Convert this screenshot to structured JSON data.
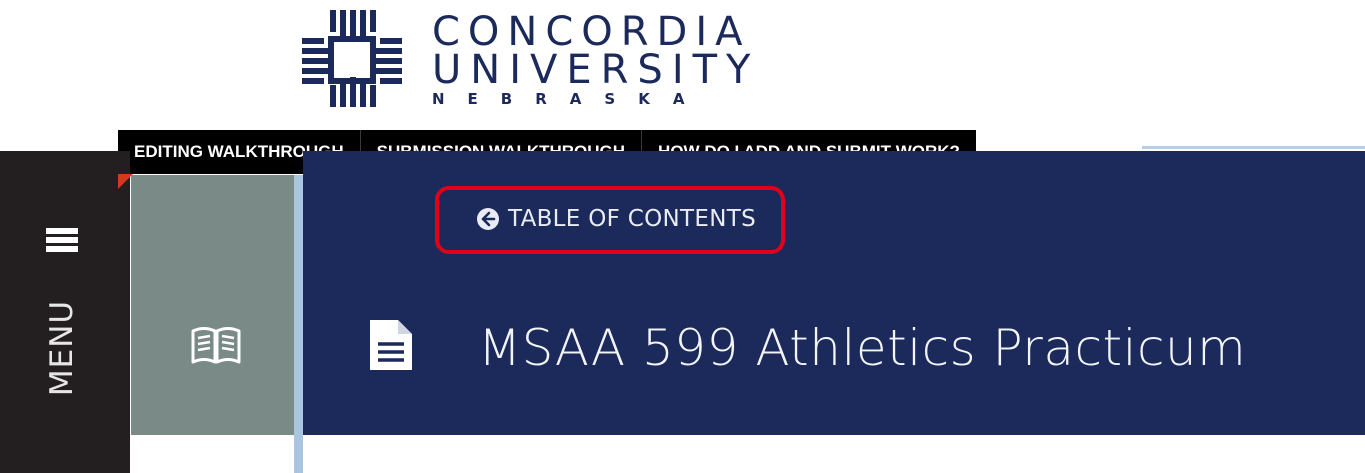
{
  "logo": {
    "line1": "CONCORDIA",
    "line2": "UNIVERSITY",
    "line3": "NEBRASKA",
    "color": "#1b2a5a"
  },
  "tabs": [
    {
      "label": "EDITING WALKTHROUGH"
    },
    {
      "label": "SUBMISSION WALKTHROUGH"
    },
    {
      "label": "HOW DO I ADD AND SUBMIT WORK?"
    }
  ],
  "sidebar": {
    "menu_label": "MENU",
    "menu_icon": "hamburger-icon",
    "book_icon": "open-book-icon"
  },
  "header": {
    "toc_label": "TABLE OF CONTENTS",
    "toc_icon": "arrow-left-circle-icon",
    "doc_icon": "document-icon",
    "course_title": "MSAA 599 Athletics Practicum"
  },
  "colors": {
    "navy": "#1b2a5a",
    "sidebar": "#231f20",
    "book_panel": "#7a8a87",
    "highlight": "#e1001a",
    "accent_line": "#a9c5e0"
  }
}
